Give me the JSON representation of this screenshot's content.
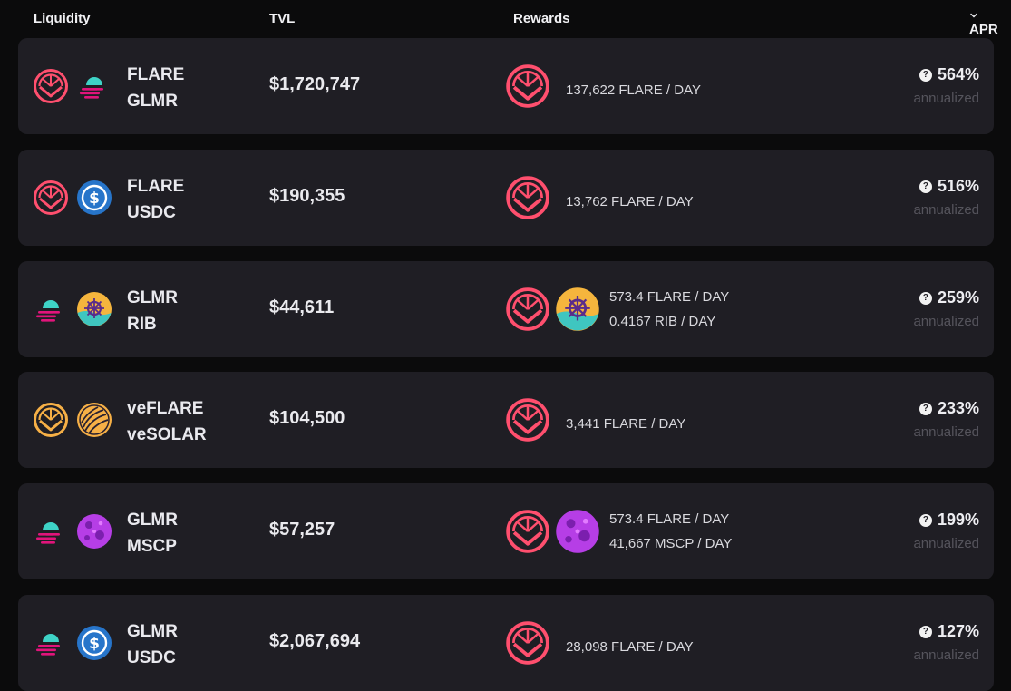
{
  "header": {
    "liquidity": "Liquidity",
    "tvl": "TVL",
    "rewards": "Rewards",
    "apr": "APR"
  },
  "colors": {
    "background": "#0b0b0c",
    "row_background": "#1f1e24",
    "flare_accent": "#ff4f6e",
    "glmr_teal": "#3ed3c6",
    "glmr_pink": "#e1147b",
    "usdc_blue": "#2775ca",
    "rib_gold": "#f5b53d",
    "veflare_orange": "#f6b046",
    "mscp_purple": "#b63ee6",
    "muted_text": "#55545c"
  },
  "rows": [
    {
      "tokens": [
        "flare-icon",
        "glmr-icon"
      ],
      "pair_top": "FLARE",
      "pair_bottom": "GLMR",
      "tvl": "$1,720,747",
      "reward_icons": [
        "flare-icon"
      ],
      "rewards": [
        "137,622 FLARE / DAY"
      ],
      "apr": "564%",
      "apr_sub": "annualized"
    },
    {
      "tokens": [
        "flare-icon",
        "usdc-icon"
      ],
      "pair_top": "FLARE",
      "pair_bottom": "USDC",
      "tvl": "$190,355",
      "reward_icons": [
        "flare-icon"
      ],
      "rewards": [
        "13,762 FLARE / DAY"
      ],
      "apr": "516%",
      "apr_sub": "annualized"
    },
    {
      "tokens": [
        "glmr-icon",
        "rib-icon"
      ],
      "pair_top": "GLMR",
      "pair_bottom": "RIB",
      "tvl": "$44,611",
      "reward_icons": [
        "flare-icon",
        "rib-icon"
      ],
      "rewards": [
        "573.4 FLARE / DAY",
        "0.4167 RIB / DAY"
      ],
      "apr": "259%",
      "apr_sub": "annualized"
    },
    {
      "tokens": [
        "veflare-icon",
        "vesolar-icon"
      ],
      "pair_top": "veFLARE",
      "pair_bottom": "veSOLAR",
      "tvl": "$104,500",
      "reward_icons": [
        "flare-icon"
      ],
      "rewards": [
        "3,441 FLARE / DAY"
      ],
      "apr": "233%",
      "apr_sub": "annualized"
    },
    {
      "tokens": [
        "glmr-icon",
        "mscp-icon"
      ],
      "pair_top": "GLMR",
      "pair_bottom": "MSCP",
      "tvl": "$57,257",
      "reward_icons": [
        "flare-icon",
        "mscp-icon"
      ],
      "rewards": [
        "573.4 FLARE / DAY",
        "41,667 MSCP / DAY"
      ],
      "apr": "199%",
      "apr_sub": "annualized"
    },
    {
      "tokens": [
        "glmr-icon",
        "usdc-icon"
      ],
      "pair_top": "GLMR",
      "pair_bottom": "USDC",
      "tvl": "$2,067,694",
      "reward_icons": [
        "flare-icon"
      ],
      "rewards": [
        "28,098 FLARE / DAY"
      ],
      "apr": "127%",
      "apr_sub": "annualized"
    }
  ]
}
